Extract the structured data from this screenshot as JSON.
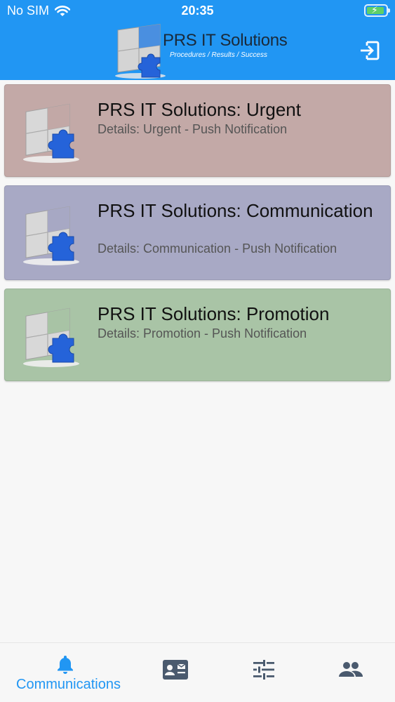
{
  "status_bar": {
    "carrier": "No SIM",
    "time": "20:35",
    "wifi_icon": "wifi-icon",
    "battery_icon": "battery-charging-icon"
  },
  "header": {
    "logo_title": "PRS IT Solutions",
    "logo_tagline": "Procedures / Results / Success",
    "logout_icon": "logout-icon",
    "color": "#2196f3"
  },
  "notifications": [
    {
      "title": "PRS IT Solutions: Urgent",
      "details": "Details: Urgent - Push Notification",
      "color": "#c3a9a7"
    },
    {
      "title": "PRS IT Solutions: Communication",
      "details": "Details: Communication - Push Notification",
      "color": "#a8a9c5"
    },
    {
      "title": "PRS IT Solutions: Promotion",
      "details": "Details: Promotion - Push Notification",
      "color": "#a9c4a6"
    }
  ],
  "tabs": [
    {
      "label": "Communications",
      "icon": "bell-icon",
      "active": true
    },
    {
      "label": "",
      "icon": "contact-card-icon",
      "active": false
    },
    {
      "label": "",
      "icon": "sliders-icon",
      "active": false
    },
    {
      "label": "",
      "icon": "people-icon",
      "active": false
    }
  ],
  "colors": {
    "accent": "#2196f3",
    "inactive_icon": "#4a5a6e"
  }
}
